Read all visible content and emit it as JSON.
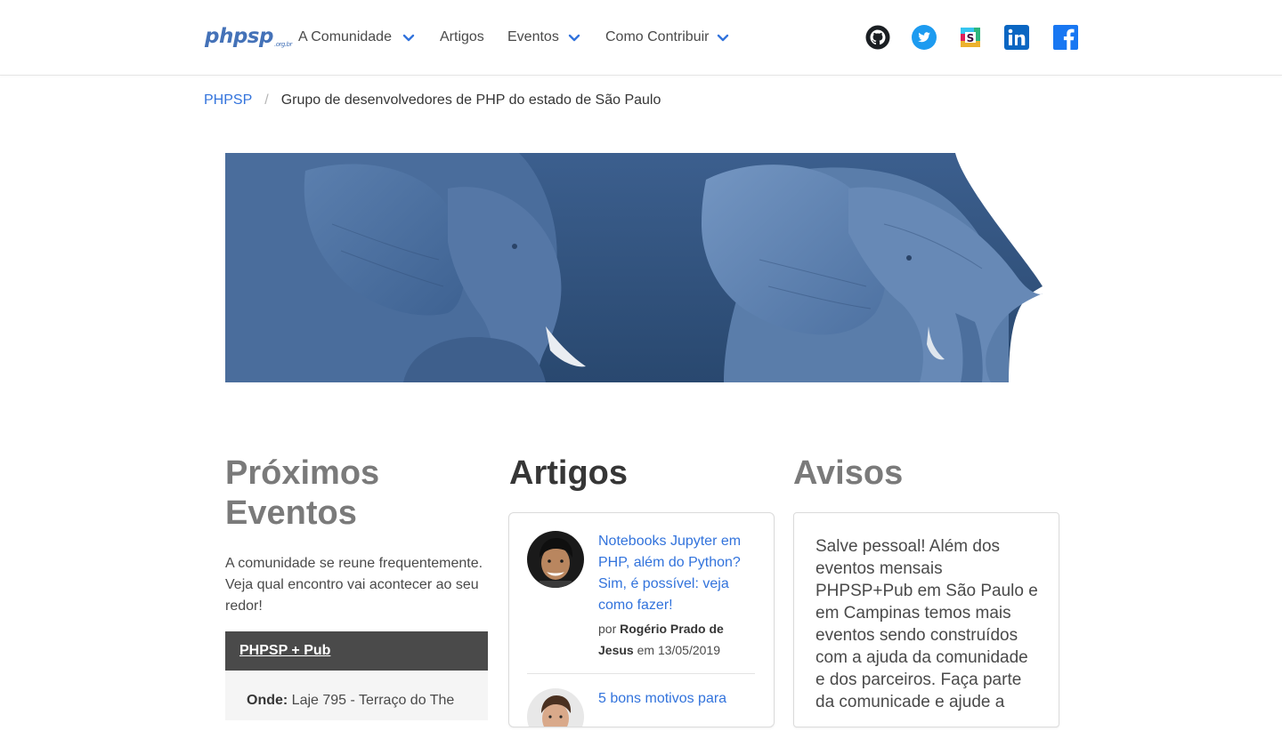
{
  "navbar": {
    "logo_text": "phpsp",
    "logo_suffix": ".org.br",
    "items": [
      {
        "label": "A Comunidade",
        "has_dropdown": true
      },
      {
        "label": "Artigos",
        "has_dropdown": false
      },
      {
        "label": "Eventos",
        "has_dropdown": true
      },
      {
        "label": "Como Contribuir",
        "has_dropdown": true
      }
    ],
    "social": [
      "github-icon",
      "twitter-icon",
      "slack-icon",
      "linkedin-icon",
      "facebook-icon"
    ]
  },
  "breadcrumb": {
    "root": "PHPSP",
    "separator": "/",
    "current": "Grupo de desenvolvedores de PHP do estado de São Paulo"
  },
  "events": {
    "title": "Próximos Eventos",
    "description": "A comunidade se reune frequentemente. Veja qual encontro vai acontecer ao seu redor!",
    "card": {
      "name": "PHPSP + Pub",
      "where_label": "Onde:",
      "where_value": "Laje 795 - Terraço do The"
    }
  },
  "articles": {
    "title": "Artigos",
    "items": [
      {
        "title": "Notebooks Jupyter em PHP, além do Python? Sim, é possível: veja como fazer!",
        "by": "por",
        "author": "Rogério Prado de Jesus",
        "on": "em",
        "date": "13/05/2019"
      },
      {
        "title": "5 bons motivos para"
      }
    ]
  },
  "notices": {
    "title": "Avisos",
    "text": "Salve pessoal! Além dos eventos mensais PHPSP+Pub em São Paulo e em Campinas temos mais eventos sendo construídos com a ajuda da comunidade e dos parceiros. Faça parte da comunicade e ajude a"
  },
  "colors": {
    "link": "#3273dc",
    "logo": "#4472b8",
    "muted_heading": "#7a7a7a",
    "event_header": "#4a4a4a"
  }
}
